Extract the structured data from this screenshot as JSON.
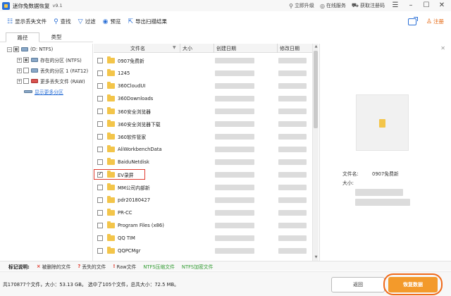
{
  "titlebar": {
    "app_name": "迷你兔数据恢复",
    "version": "v9.1",
    "links": [
      {
        "label": "立即升级",
        "icon": "upgrade-icon"
      },
      {
        "label": "在线服务",
        "icon": "headset-icon"
      },
      {
        "label": "获取注册码",
        "icon": "cart-icon"
      }
    ]
  },
  "toolbar": {
    "show_lost_files": "显示丢失文件",
    "find": "查找",
    "filter": "过滤",
    "preview": "预览",
    "export_results": "导出扫描结果",
    "register": "注册"
  },
  "tabs": [
    "路径",
    "类型"
  ],
  "tree": {
    "root": "(D: NTFS)",
    "items": [
      "存在的分区 (NTFS)",
      "丢失的分区 1 (FAT12)",
      "更多丢失文件 (RAW)"
    ],
    "link": "显示更多分区"
  },
  "columns": {
    "name": "文件名",
    "size": "大小",
    "created": "创建日期",
    "modified": "修改日期"
  },
  "files": [
    {
      "name": "0907免费新",
      "checked": false
    },
    {
      "name": "1245",
      "checked": false
    },
    {
      "name": "360CloudUI",
      "checked": false
    },
    {
      "name": "360Downloads",
      "checked": false
    },
    {
      "name": "360安全浏览器",
      "checked": false
    },
    {
      "name": "360安全浏览器下载",
      "checked": false
    },
    {
      "name": "360软件管家",
      "checked": false
    },
    {
      "name": "AliWorkbenchData",
      "checked": false
    },
    {
      "name": "BaiduNetdisk",
      "checked": false
    },
    {
      "name": "EV录屏",
      "checked": true
    },
    {
      "name": "MM公司内部新",
      "checked": false
    },
    {
      "name": "pdr20180427",
      "checked": false
    },
    {
      "name": "PR-CC",
      "checked": false
    },
    {
      "name": "Program Files (x86)",
      "checked": false
    },
    {
      "name": "QQ TIM",
      "checked": false
    },
    {
      "name": "QQPCMgr",
      "checked": false
    }
  ],
  "preview": {
    "name_label": "文件名:",
    "name_value": "0907免费新",
    "size_label": "大小:"
  },
  "legend": {
    "title": "标记说明:",
    "items": [
      {
        "sym": "×",
        "label": "被删除的文件",
        "color": "#e03b2f"
      },
      {
        "sym": "?",
        "label": "丢失的文件",
        "color": "#e03b2f"
      },
      {
        "sym": "!",
        "label": "Raw文件",
        "color": "#e03b2f"
      },
      {
        "sym": "",
        "label": "NTFS压缩文件",
        "color": "#2f9a2f"
      },
      {
        "sym": "",
        "label": "NTFS加密文件",
        "color": "#2f9a2f"
      }
    ]
  },
  "status": {
    "summary": "共170877个文件，大小：53.13 GB。 选中了105个文件，总共大小：72.5 MB。",
    "back": "返回",
    "recover": "恢复数据"
  }
}
